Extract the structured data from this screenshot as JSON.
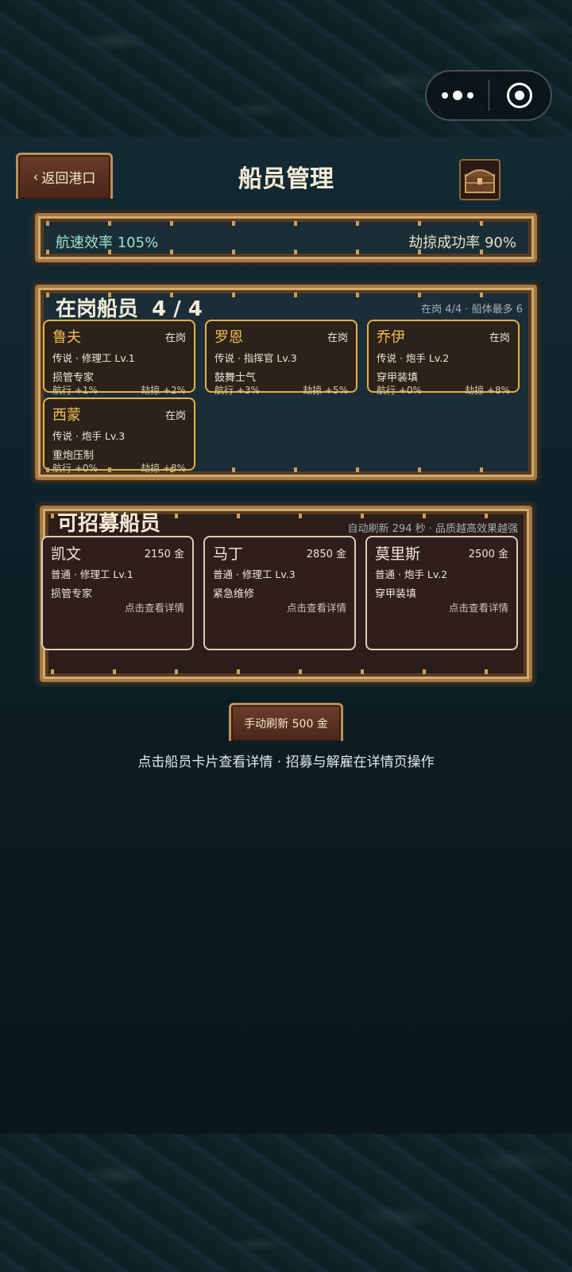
{
  "header": {
    "back_label": "返回港口",
    "title": "船员管理"
  },
  "stats": {
    "speed_label": "航速效率",
    "speed_value": "105%",
    "plunder_label": "劫掠成功率",
    "plunder_value": "90%"
  },
  "crew_panel": {
    "title": "在岗船员",
    "count": "4 / 4",
    "subtitle": "在岗 4/4 · 船体最多 6",
    "members": [
      {
        "name": "鲁夫",
        "status": "在岗",
        "info": "传说 · 修理工 Lv.1",
        "skill": "损管专家",
        "sail": "航行 +1%",
        "plunder": "劫掠 +2%"
      },
      {
        "name": "罗恩",
        "status": "在岗",
        "info": "传说 · 指挥官 Lv.3",
        "skill": "鼓舞士气",
        "sail": "航行 +3%",
        "plunder": "劫掠 +5%"
      },
      {
        "name": "乔伊",
        "status": "在岗",
        "info": "传说 · 炮手 Lv.2",
        "skill": "穿甲装填",
        "sail": "航行 +0%",
        "plunder": "劫掠 +8%"
      },
      {
        "name": "西蒙",
        "status": "在岗",
        "info": "传说 · 炮手 Lv.3",
        "skill": "重炮压制",
        "sail": "航行 +0%",
        "plunder": "劫掠 +8%"
      }
    ]
  },
  "recruit_panel": {
    "title": "可招募船员",
    "subtitle": "自动刷新 294 秒 · 品质越高效果越强",
    "candidates": [
      {
        "name": "凯文",
        "price": "2150 金",
        "info": "普通 · 修理工 Lv.1",
        "skill": "损管专家",
        "hint": "点击查看详情"
      },
      {
        "name": "马丁",
        "price": "2850 金",
        "info": "普通 · 修理工 Lv.3",
        "skill": "紧急维修",
        "hint": "点击查看详情"
      },
      {
        "name": "莫里斯",
        "price": "2500 金",
        "info": "普通 · 炮手 Lv.2",
        "skill": "穿甲装填",
        "hint": "点击查看详情"
      }
    ]
  },
  "refresh_button": "手动刷新 500 金",
  "footer_tip": "点击船员卡片查看详情 · 招募与解雇在详情页操作"
}
